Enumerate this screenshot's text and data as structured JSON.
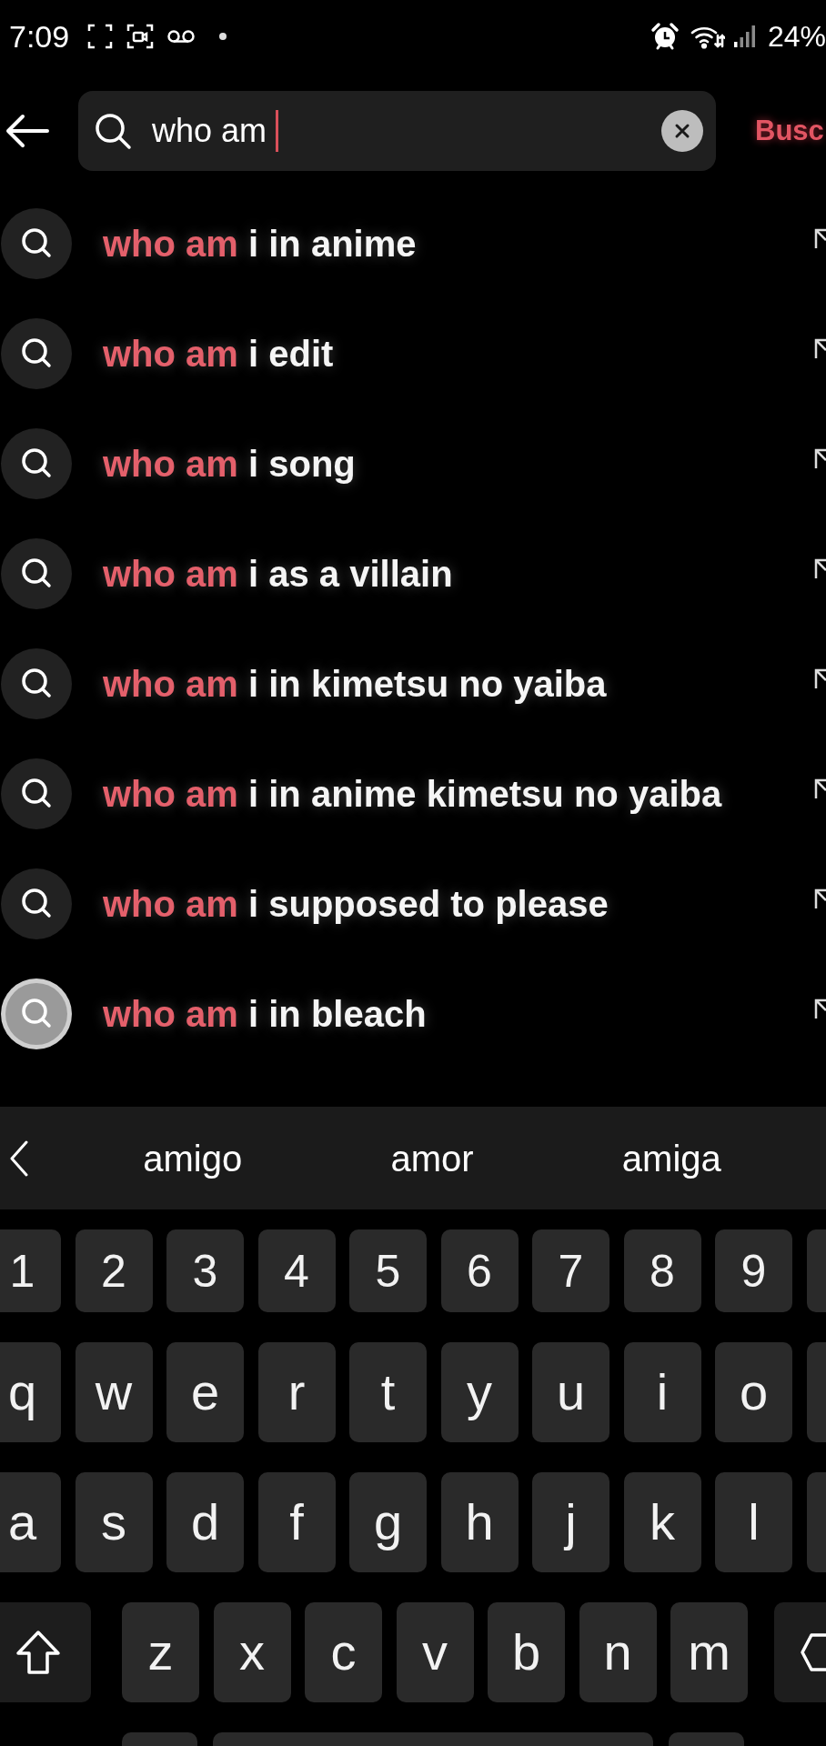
{
  "status_bar": {
    "time": "7:09",
    "battery": "24%"
  },
  "search": {
    "value": "who am",
    "action": "Busc"
  },
  "suggestions": [
    {
      "highlight": "who am",
      "rest": "i in anime",
      "pressed": false
    },
    {
      "highlight": "who am",
      "rest": "i edit",
      "pressed": false
    },
    {
      "highlight": "who am",
      "rest": "i song",
      "pressed": false
    },
    {
      "highlight": "who am",
      "rest": "i as a villain",
      "pressed": false
    },
    {
      "highlight": "who am",
      "rest": "i in kimetsu no yaiba",
      "pressed": false
    },
    {
      "highlight": "who am",
      "rest": "i in anime kimetsu no yaiba",
      "pressed": false
    },
    {
      "highlight": "who am",
      "rest": "i supposed to please",
      "pressed": false
    },
    {
      "highlight": "who am",
      "rest": "i in bleach",
      "pressed": true
    }
  ],
  "keyboard": {
    "suggestions": [
      "amigo",
      "amor",
      "amiga"
    ],
    "rows": [
      {
        "kind": "numbers",
        "keys": [
          {
            "kind": "edge",
            "label": "1"
          },
          {
            "kind": "char",
            "label": "2"
          },
          {
            "kind": "char",
            "label": "3"
          },
          {
            "kind": "char",
            "label": "4"
          },
          {
            "kind": "char",
            "label": "5"
          },
          {
            "kind": "char",
            "label": "6"
          },
          {
            "kind": "char",
            "label": "7"
          },
          {
            "kind": "char",
            "label": "8"
          },
          {
            "kind": "char",
            "label": "9"
          },
          {
            "kind": "blank"
          }
        ]
      },
      {
        "kind": "letters",
        "keys": [
          {
            "kind": "edge",
            "label": "q"
          },
          {
            "kind": "char",
            "label": "w"
          },
          {
            "kind": "char",
            "label": "e"
          },
          {
            "kind": "char",
            "label": "r"
          },
          {
            "kind": "char",
            "label": "t"
          },
          {
            "kind": "char",
            "label": "y"
          },
          {
            "kind": "char",
            "label": "u"
          },
          {
            "kind": "char",
            "label": "i"
          },
          {
            "kind": "char",
            "label": "o"
          },
          {
            "kind": "blank"
          }
        ]
      },
      {
        "kind": "letters",
        "keys": [
          {
            "kind": "edge",
            "label": "a"
          },
          {
            "kind": "char",
            "label": "s"
          },
          {
            "kind": "char",
            "label": "d"
          },
          {
            "kind": "char",
            "label": "f"
          },
          {
            "kind": "char",
            "label": "g"
          },
          {
            "kind": "char",
            "label": "h"
          },
          {
            "kind": "char",
            "label": "j"
          },
          {
            "kind": "char",
            "label": "k"
          },
          {
            "kind": "char",
            "label": "l"
          },
          {
            "kind": "blank"
          }
        ]
      },
      {
        "kind": "shift",
        "keys": [
          {
            "kind": "shift"
          },
          {
            "kind": "char",
            "label": "z"
          },
          {
            "kind": "char",
            "label": "x"
          },
          {
            "kind": "char",
            "label": "c"
          },
          {
            "kind": "char",
            "label": "v"
          },
          {
            "kind": "char",
            "label": "b"
          },
          {
            "kind": "char",
            "label": "n"
          },
          {
            "kind": "char",
            "label": "m"
          },
          {
            "kind": "backspace"
          }
        ]
      },
      {
        "kind": "bottom",
        "keys": [
          {
            "kind": "stub"
          },
          {
            "kind": "space"
          },
          {
            "kind": "stub"
          }
        ]
      }
    ]
  }
}
